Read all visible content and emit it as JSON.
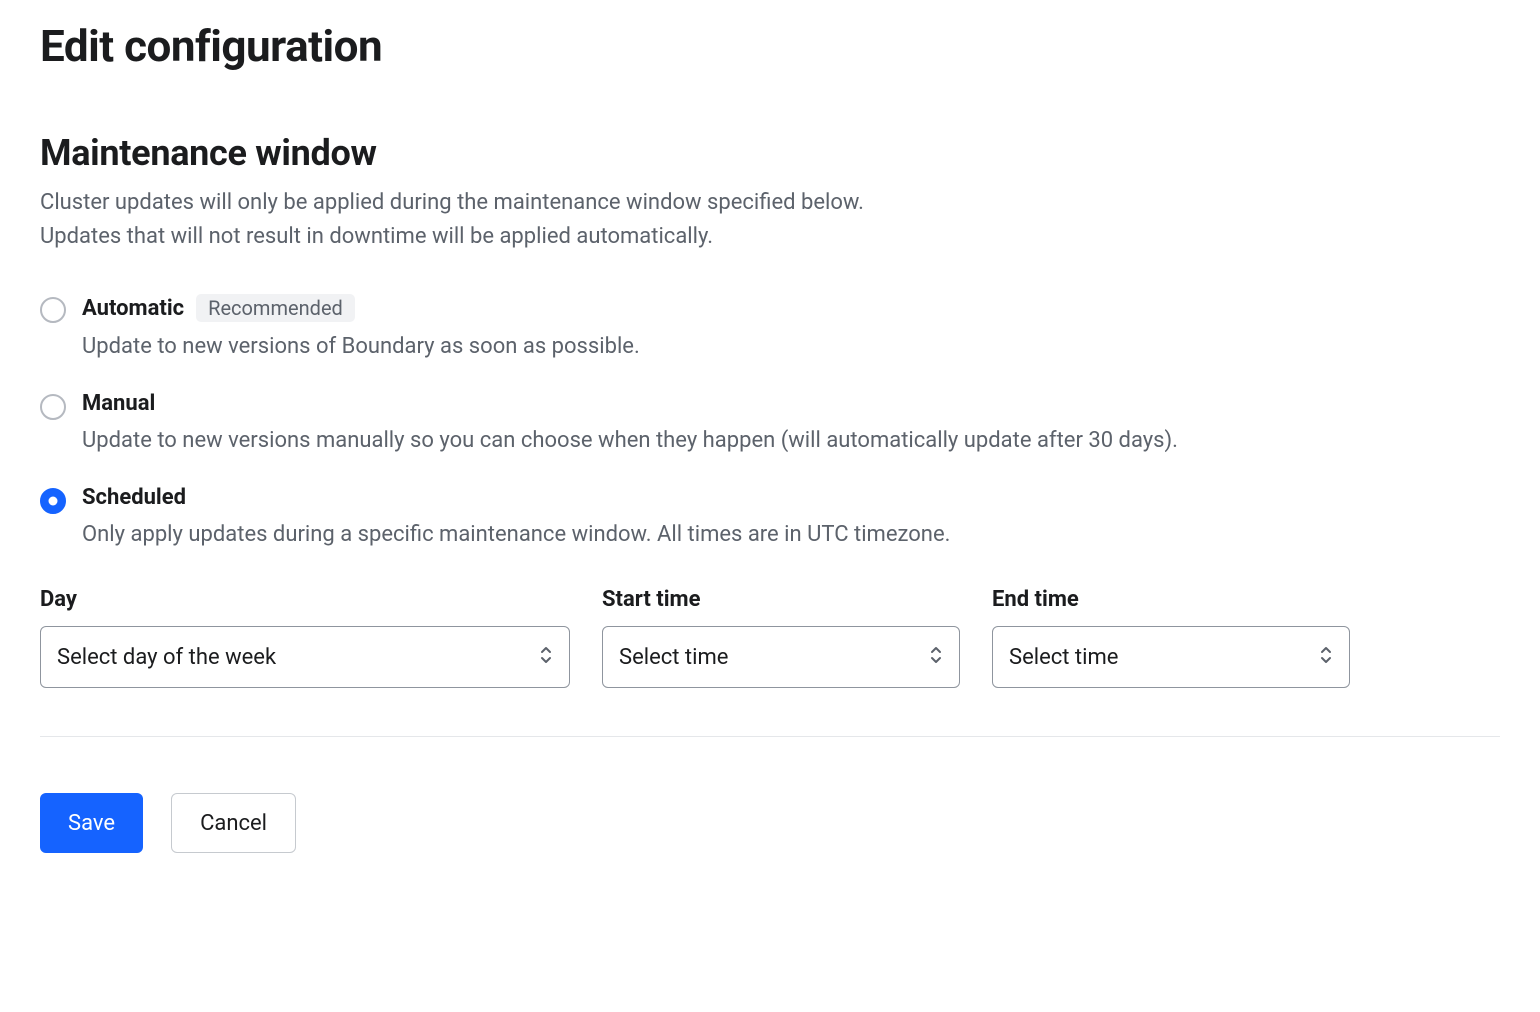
{
  "page": {
    "title": "Edit configuration"
  },
  "section": {
    "title": "Maintenance window",
    "description_line1": "Cluster updates will only be applied during the maintenance window specified below.",
    "description_line2": "Updates that will not result in downtime will be applied automatically."
  },
  "options": {
    "automatic": {
      "label": "Automatic",
      "badge": "Recommended",
      "description": "Update to new versions of Boundary as soon as possible.",
      "selected": false
    },
    "manual": {
      "label": "Manual",
      "description": "Update to new versions manually so you can choose when they happen (will automatically update after 30 days).",
      "selected": false
    },
    "scheduled": {
      "label": "Scheduled",
      "description": "Only apply updates during a specific maintenance window. All times are in UTC timezone.",
      "selected": true
    }
  },
  "fields": {
    "day": {
      "label": "Day",
      "value": "Select day of the week"
    },
    "start_time": {
      "label": "Start time",
      "value": "Select time"
    },
    "end_time": {
      "label": "End time",
      "value": "Select time"
    }
  },
  "actions": {
    "save": "Save",
    "cancel": "Cancel"
  }
}
